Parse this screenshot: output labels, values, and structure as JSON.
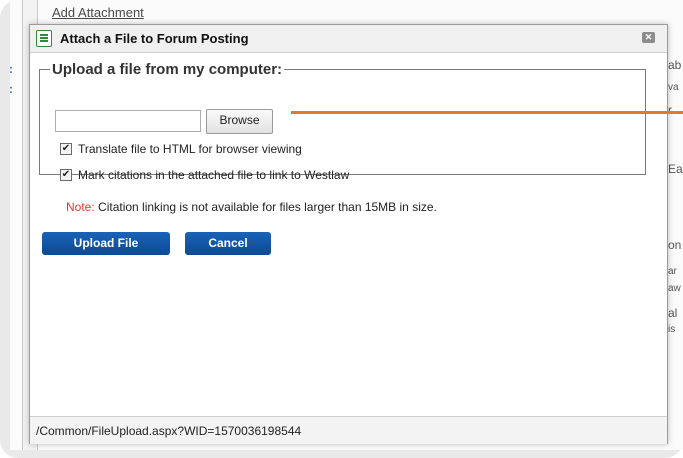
{
  "background": {
    "link": "Add Attachment",
    "right_fragments": [
      "ab",
      "va",
      "r",
      "Eas",
      "on",
      "ar",
      "aw",
      "al",
      "is"
    ],
    "left_marker": ":"
  },
  "dialog": {
    "title": "Attach a File to Forum Posting",
    "close_glyph": "✕",
    "fieldset_legend": "Upload a file from my computer:",
    "file_input_value": "",
    "browse_label": "Browse",
    "options": [
      {
        "label": "Translate file to HTML for browser viewing",
        "checked": true
      },
      {
        "label": "Mark citations in the attached file to link to Westlaw",
        "checked": true
      }
    ],
    "note_key": "Note:",
    "note_text": "Citation linking is not available for files larger than 15MB in size.",
    "upload_label": "Upload File",
    "cancel_label": "Cancel",
    "status_url": "/Common/FileUpload.aspx?WID=1570036198544"
  },
  "colors": {
    "primary_button": "#0f52a0",
    "note_accent": "#e03a2a",
    "callout": "#e87722",
    "icon": "#2f8a3a"
  },
  "icons": [
    "document-icon",
    "close-icon",
    "checkmark-icon"
  ]
}
